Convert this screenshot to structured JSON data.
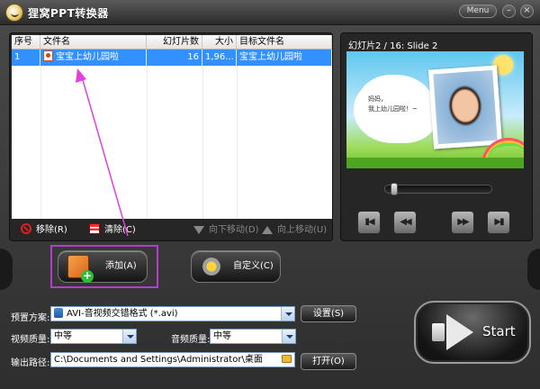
{
  "app": {
    "title": "狸窝PPT转换器",
    "menu_label": "Menu",
    "minimize": "–",
    "close": "×"
  },
  "file_list": {
    "columns": [
      "序号",
      "文件名",
      "幻灯片数",
      "大小",
      "目标文件名"
    ],
    "rows": [
      {
        "index": "1",
        "filename": "宝宝上幼儿园啦",
        "slides": "16",
        "size": "1,96...",
        "target": "宝宝上幼儿园啦",
        "selected": true
      }
    ],
    "toolbar": {
      "remove": "移除(R)",
      "clear": "清除(C)",
      "move_down": "向下移动(D)",
      "move_up": "向上移动(U)"
    }
  },
  "preview": {
    "slide_label": "幻灯片2 / 16: Slide 2",
    "slide_text": "妈妈，\n我上幼儿园啦！~",
    "seek_position": 0.05,
    "controls": [
      "first",
      "previous",
      "next",
      "last"
    ]
  },
  "actions": {
    "add": "添加(A)",
    "custom": "自定义(C)"
  },
  "settings": {
    "preset_label": "预置方案:",
    "preset_value": "AVI-音视频交错格式 (*.avi)",
    "settings_button": "设置(S)",
    "video_quality_label": "视频质量:",
    "video_quality_value": "中等",
    "audio_quality_label": "音频质量:",
    "audio_quality_value": "中等",
    "output_label": "输出路径:",
    "output_value": "C:\\Documents and Settings\\Administrator\\桌面",
    "open_button": "打开(O)"
  },
  "start_label": "Start",
  "colors": {
    "selection": "#3390ff",
    "highlight_box": "#b040c8",
    "annotation_arrow": "#e040e0"
  }
}
